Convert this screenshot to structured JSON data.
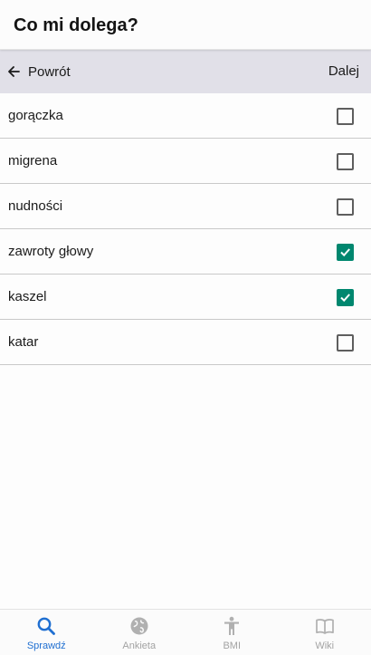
{
  "header": {
    "title": "Co mi dolega?"
  },
  "nav": {
    "back_label": "Powrót",
    "next_label": "Dalej"
  },
  "symptoms": [
    {
      "label": "gorączka",
      "checked": false
    },
    {
      "label": "migrena",
      "checked": false
    },
    {
      "label": "nudności",
      "checked": false
    },
    {
      "label": "zawroty głowy",
      "checked": true
    },
    {
      "label": "kaszel",
      "checked": true
    },
    {
      "label": "katar",
      "checked": false
    }
  ],
  "tabs": [
    {
      "label": "Sprawdź",
      "icon": "search-icon",
      "active": true
    },
    {
      "label": "Ankieta",
      "icon": "globe-icon",
      "active": false
    },
    {
      "label": "BMI",
      "icon": "person-icon",
      "active": false
    },
    {
      "label": "Wiki",
      "icon": "book-icon",
      "active": false
    }
  ],
  "colors": {
    "accent": "#1f6fd1",
    "checkbox_checked": "#00876f",
    "nav_bar_bg": "#e1e0e8",
    "inactive_tab": "#a3a3a3"
  }
}
